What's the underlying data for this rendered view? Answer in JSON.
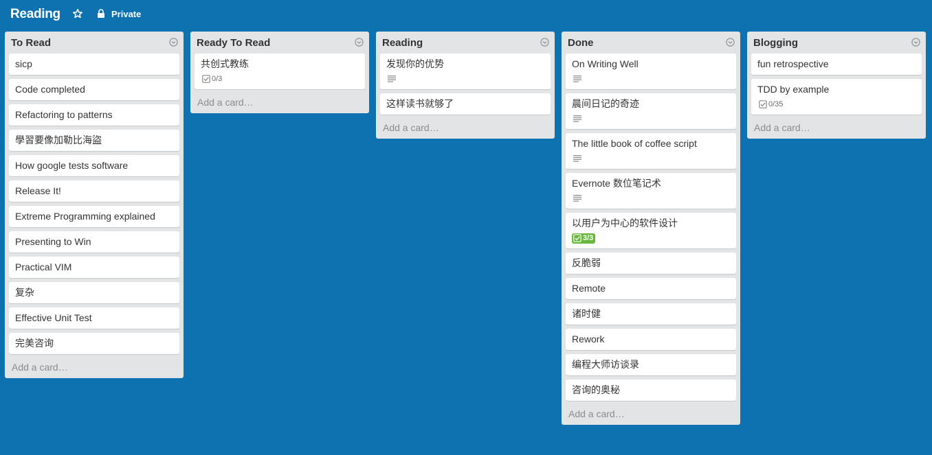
{
  "board": {
    "title": "Reading",
    "privacy": "Private"
  },
  "lists": [
    {
      "title": "To Read",
      "add_card": "Add a card…",
      "cards": [
        {
          "title": "sicp"
        },
        {
          "title": "Code completed"
        },
        {
          "title": "Refactoring to patterns"
        },
        {
          "title": "學習要像加勒比海盜"
        },
        {
          "title": "How google tests software"
        },
        {
          "title": "Release It!"
        },
        {
          "title": "Extreme Programming explained"
        },
        {
          "title": "Presenting to Win"
        },
        {
          "title": "Practical VIM"
        },
        {
          "title": "复杂"
        },
        {
          "title": "Effective Unit Test"
        },
        {
          "title": "完美咨询"
        }
      ]
    },
    {
      "title": "Ready To Read",
      "add_card": "Add a card…",
      "cards": [
        {
          "title": "共创式教练",
          "checklist": "0/3"
        }
      ]
    },
    {
      "title": "Reading",
      "add_card": "Add a card…",
      "cards": [
        {
          "title": "发现你的优势",
          "has_description": true
        },
        {
          "title": "这样读书就够了"
        }
      ]
    },
    {
      "title": "Done",
      "add_card": "Add a card…",
      "cards": [
        {
          "title": "On Writing Well",
          "has_description": true
        },
        {
          "title": "晨间日记的奇迹",
          "has_description": true
        },
        {
          "title": "The little book of coffee script",
          "has_description": true
        },
        {
          "title": "Evernote 数位笔记术",
          "has_description": true
        },
        {
          "title": "以用户为中心的软件设计",
          "checklist": "3/3",
          "checklist_complete": true
        },
        {
          "title": "反脆弱"
        },
        {
          "title": "Remote"
        },
        {
          "title": "诸时健"
        },
        {
          "title": "Rework"
        },
        {
          "title": "编程大师访谈录"
        },
        {
          "title": "咨询的奥秘"
        }
      ]
    },
    {
      "title": "Blogging",
      "add_card": "Add a card…",
      "cards": [
        {
          "title": "fun retrospective"
        },
        {
          "title": "TDD by example",
          "checklist": "0/35"
        }
      ]
    }
  ],
  "colors": {
    "background": "#0f72b0",
    "list": "#e2e4e6",
    "complete_badge": "#6ab73d"
  },
  "icons": {
    "star": "star-icon",
    "lock": "lock-icon",
    "list_menu": "chevron-down-circle-icon",
    "description": "description-icon",
    "checklist": "checklist-icon"
  }
}
